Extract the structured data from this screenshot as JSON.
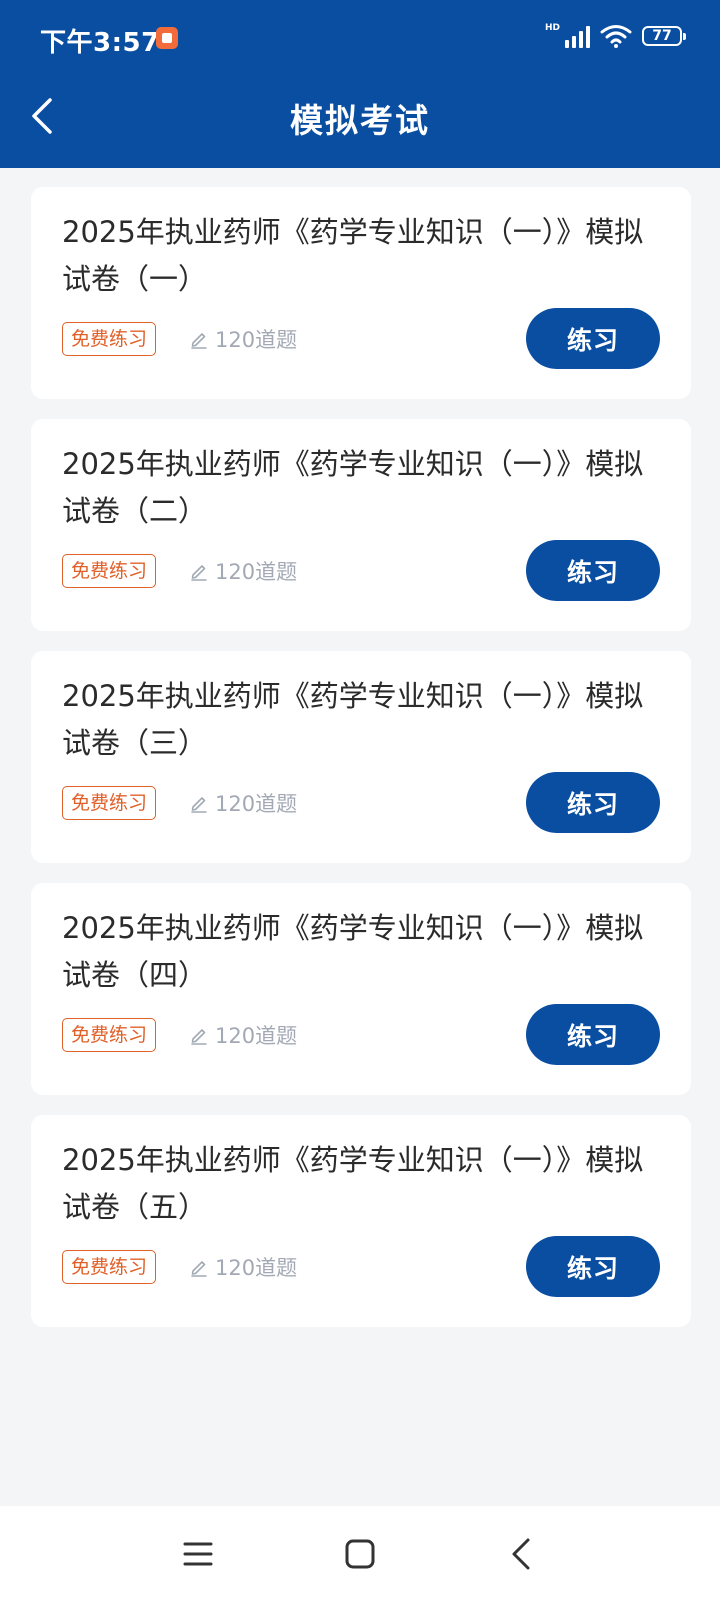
{
  "status_bar": {
    "time": "下午3:57",
    "network_badge": "HD",
    "battery_level": "77"
  },
  "header": {
    "title": "模拟考试",
    "back_icon": "chevron-left-icon"
  },
  "exams": [
    {
      "title": "2025年执业药师《药学专业知识（一）》模拟试卷（一）",
      "tag": "免费练习",
      "question_count": "120道题",
      "action_label": "练习"
    },
    {
      "title": "2025年执业药师《药学专业知识（一）》模拟试卷（二）",
      "tag": "免费练习",
      "question_count": "120道题",
      "action_label": "练习"
    },
    {
      "title": "2025年执业药师《药学专业知识（一）》模拟试卷（三）",
      "tag": "免费练习",
      "question_count": "120道题",
      "action_label": "练习"
    },
    {
      "title": "2025年执业药师《药学专业知识（一）》模拟试卷（四）",
      "tag": "免费练习",
      "question_count": "120道题",
      "action_label": "练习"
    },
    {
      "title": "2025年执业药师《药学专业知识（一）》模拟试卷（五）",
      "tag": "免费练习",
      "question_count": "120道题",
      "action_label": "练习"
    }
  ],
  "navigation": {
    "menu_icon": "menu-icon",
    "home_icon": "home-square-icon",
    "back_icon": "back-triangle-icon"
  },
  "colors": {
    "primary": "#0a4ea2",
    "tag_orange": "#e0602a",
    "background": "#f4f5f7",
    "muted_text": "#a3a9b4"
  }
}
